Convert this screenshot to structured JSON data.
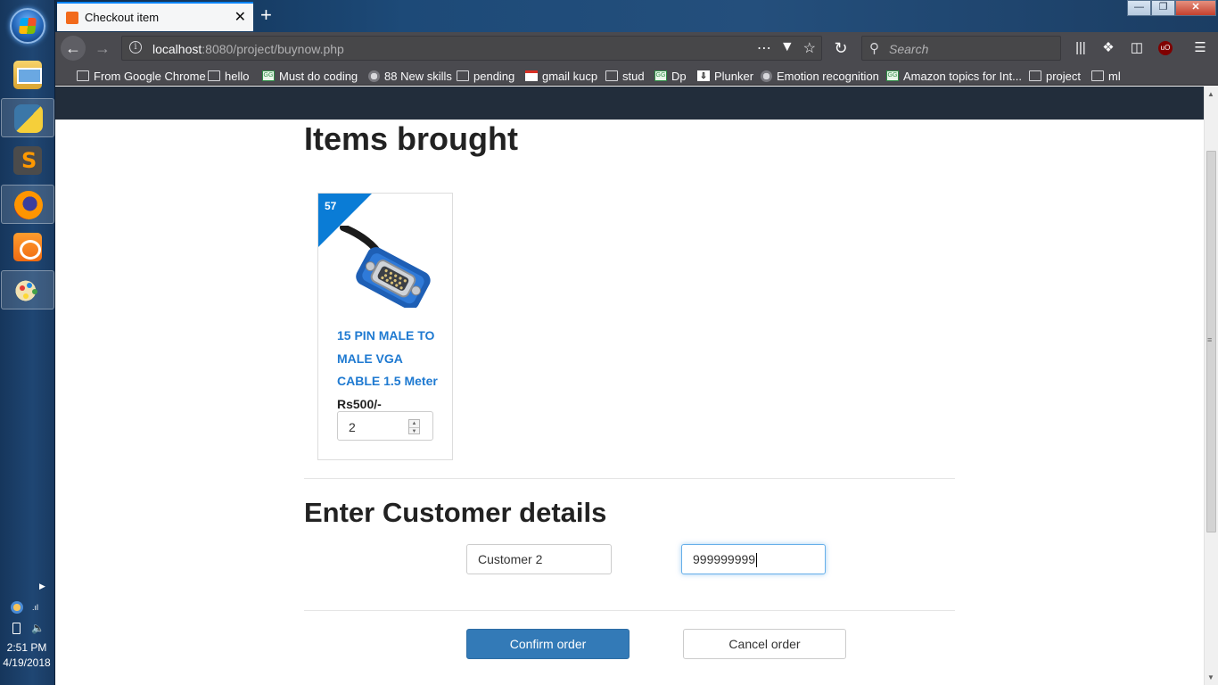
{
  "taskbar": {
    "apps": [
      "file-explorer",
      "python",
      "sublime-text",
      "firefox",
      "uc-browser",
      "paint"
    ],
    "clock": {
      "time": "2:51 PM",
      "date": "4/19/2018"
    }
  },
  "browser": {
    "tab": {
      "title": "Checkout item"
    },
    "url": {
      "host": "localhost",
      "rest": ":8080/project/buynow.php"
    },
    "search_placeholder": "Search",
    "bookmarks": [
      {
        "label": "From Google Chrome",
        "icon": "folder"
      },
      {
        "label": "hello",
        "icon": "folder"
      },
      {
        "label": "Must do coding",
        "icon": "gfg"
      },
      {
        "label": "88 New skills",
        "icon": "globe"
      },
      {
        "label": "pending",
        "icon": "folder"
      },
      {
        "label": "gmail kucp",
        "icon": "gmail"
      },
      {
        "label": "stud",
        "icon": "folder"
      },
      {
        "label": "Dp",
        "icon": "gfg"
      },
      {
        "label": "Plunker",
        "icon": "plunker"
      },
      {
        "label": "Emotion recognition",
        "icon": "globe"
      },
      {
        "label": "Amazon topics for Int...",
        "icon": "gfg"
      },
      {
        "label": "project",
        "icon": "folder"
      },
      {
        "label": "ml",
        "icon": "folder"
      }
    ]
  },
  "page": {
    "items_heading": "Items brought",
    "product": {
      "badge": "57",
      "name": "15 PIN MALE TO MALE VGA CABLE 1.5 Meter",
      "price": "Rs500/-",
      "quantity": "2"
    },
    "customer_heading": "Enter Customer details",
    "customer_name": "Customer 2",
    "customer_phone": "999999999",
    "confirm_label": "Confirm order",
    "cancel_label": "Cancel order"
  },
  "colors": {
    "accent": "#337ab7",
    "product_link": "#1f7ad1",
    "ribbon": "#0a7cd6",
    "site_nav": "#222d3b"
  }
}
